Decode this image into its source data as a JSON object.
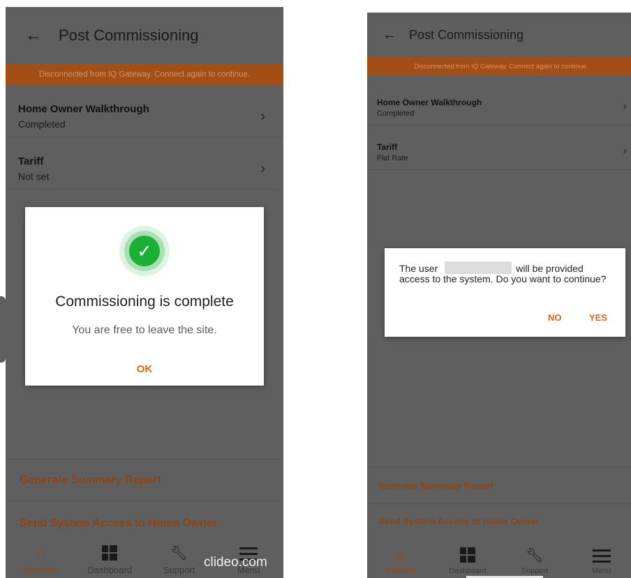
{
  "left_screen": {
    "title": "Post Commissioning",
    "banner": "Disconnected from IQ Gateway. Connect again to continue.",
    "rows": [
      {
        "title": "Home Owner Walkthrough",
        "subtitle": "Completed"
      },
      {
        "title": "Tariff",
        "subtitle": "Not set"
      }
    ],
    "actions": {
      "generate_summary": "Generate Summary Report",
      "send_access": "Send System Access to Home Owner"
    },
    "nav": [
      {
        "label": "Systems",
        "icon": "home-icon",
        "active": true
      },
      {
        "label": "Dashboard",
        "icon": "dashboard-icon"
      },
      {
        "label": "Support",
        "icon": "wrench-icon"
      },
      {
        "label": "Menu",
        "icon": "menu-icon"
      }
    ],
    "dialog": {
      "icon": "check-circle-icon",
      "title": "Commissioning is complete",
      "message": "You are free to leave the site.",
      "ok_label": "OK"
    },
    "watermark": "clideo.com"
  },
  "right_screen": {
    "title": "Post Commissioning",
    "banner": "Disconnected from IQ Gateway. Connect again to continue.",
    "rows": [
      {
        "title": "Home Owner Walkthrough",
        "subtitle": "Completed"
      },
      {
        "title": "Tariff",
        "subtitle": "Flat Rate"
      }
    ],
    "actions": {
      "generate_summary": "Generate Summary Report",
      "send_access": "Send System Access to Home Owner"
    },
    "nav": [
      {
        "label": "Systems",
        "icon": "home-icon",
        "active": true
      },
      {
        "label": "Dashboard",
        "icon": "dashboard-icon"
      },
      {
        "label": "Support",
        "icon": "wrench-icon"
      },
      {
        "label": "Menu",
        "icon": "menu-icon"
      }
    ],
    "dialog": {
      "text_before": "The user",
      "text_after": "will be provided access to the system. Do you want to continue?",
      "no_label": "NO",
      "yes_label": "YES"
    }
  },
  "colors": {
    "overlay": "#5f5f5f",
    "banner": "#a34e14",
    "accent": "#d26a16",
    "success": "#19b035"
  }
}
